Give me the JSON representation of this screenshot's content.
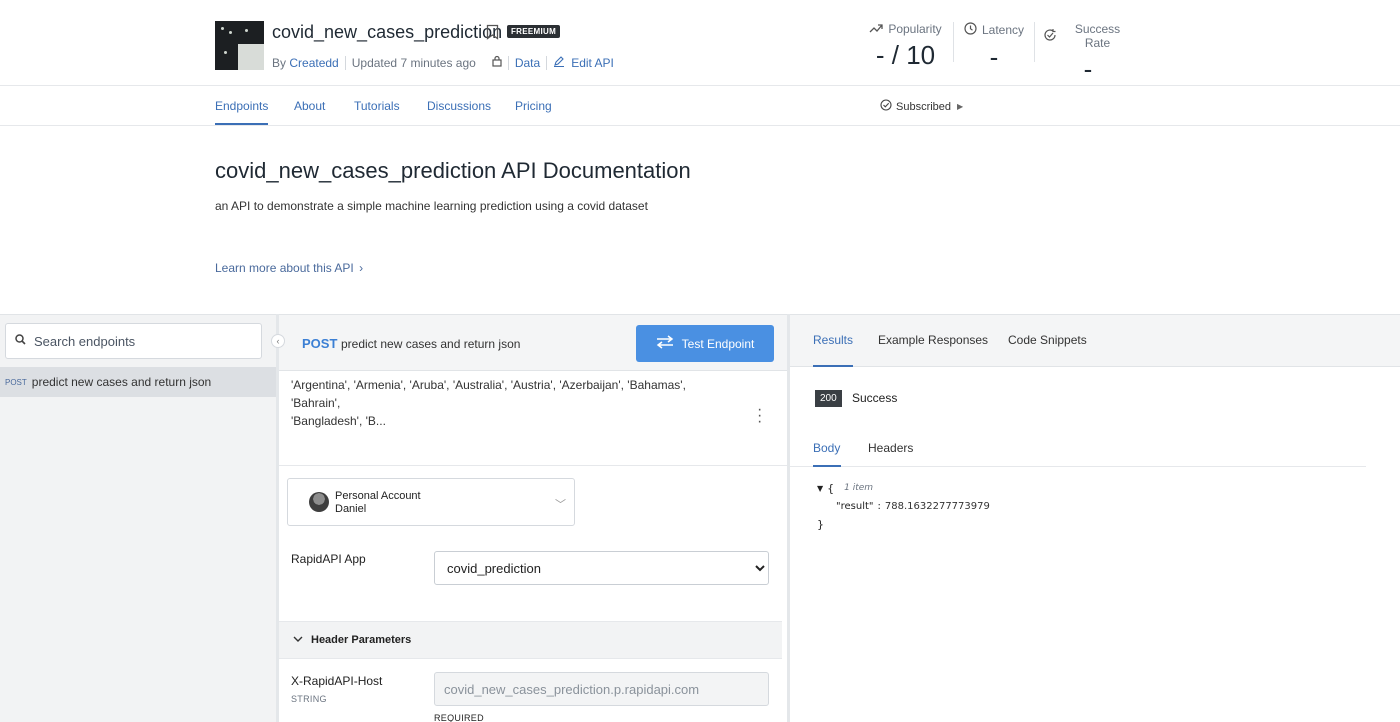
{
  "header": {
    "api_title": "covid_new_cases_prediction",
    "plan_badge": "FREEMIUM",
    "by_label": "By",
    "author": "Createdd",
    "updated": "Updated 7 minutes ago",
    "data_link": "Data",
    "edit_link": "Edit API",
    "stats": [
      {
        "label": "Popularity",
        "value": "- / 10",
        "icon": "trending-up-icon"
      },
      {
        "label": "Latency",
        "value": "-",
        "icon": "clock-icon"
      },
      {
        "label": "Success Rate",
        "value": "-",
        "icon": "check-refresh-icon"
      }
    ]
  },
  "nav": {
    "tabs": [
      "Endpoints",
      "About",
      "Tutorials",
      "Discussions",
      "Pricing"
    ],
    "active_tab": "Endpoints",
    "subscribed": "Subscribed"
  },
  "doc": {
    "title": "covid_new_cases_prediction API Documentation",
    "description": "an API to demonstrate a simple machine learning prediction using a covid dataset",
    "learn_more": "Learn more about this API"
  },
  "sidebar": {
    "search_placeholder": "Search endpoints",
    "endpoints": [
      {
        "method": "POST",
        "name": "predict new cases and return json"
      }
    ]
  },
  "endpoint": {
    "method": "POST",
    "name": "predict new cases and return json",
    "test_button": "Test Endpoint",
    "countries_preview_1": "'Argentina', 'Armenia', 'Aruba', 'Australia', 'Austria', 'Azerbaijan', 'Bahamas', 'Bahrain',",
    "countries_preview_2": "'Bangladesh', 'B...",
    "account_title": "Personal Account",
    "account_name": "Daniel",
    "app_label": "RapidAPI App",
    "app_value": "covid_prediction",
    "header_params_title": "Header Parameters",
    "host_label": "X-RapidAPI-Host",
    "host_type": "STRING",
    "host_value": "covid_new_cases_prediction.p.rapidapi.com",
    "required": "REQUIRED"
  },
  "results": {
    "tabs": [
      "Results",
      "Example Responses",
      "Code Snippets"
    ],
    "active_tab": "Results",
    "status_code": "200",
    "status_text": "Success",
    "body_tabs": [
      "Body",
      "Headers"
    ],
    "json_count": "1 item",
    "json_key": "\"result\"",
    "json_value": "788.1632277773979"
  },
  "colors": {
    "accent": "#3b6fb6",
    "button": "#4a90e2",
    "badge": "#2b2f33"
  }
}
